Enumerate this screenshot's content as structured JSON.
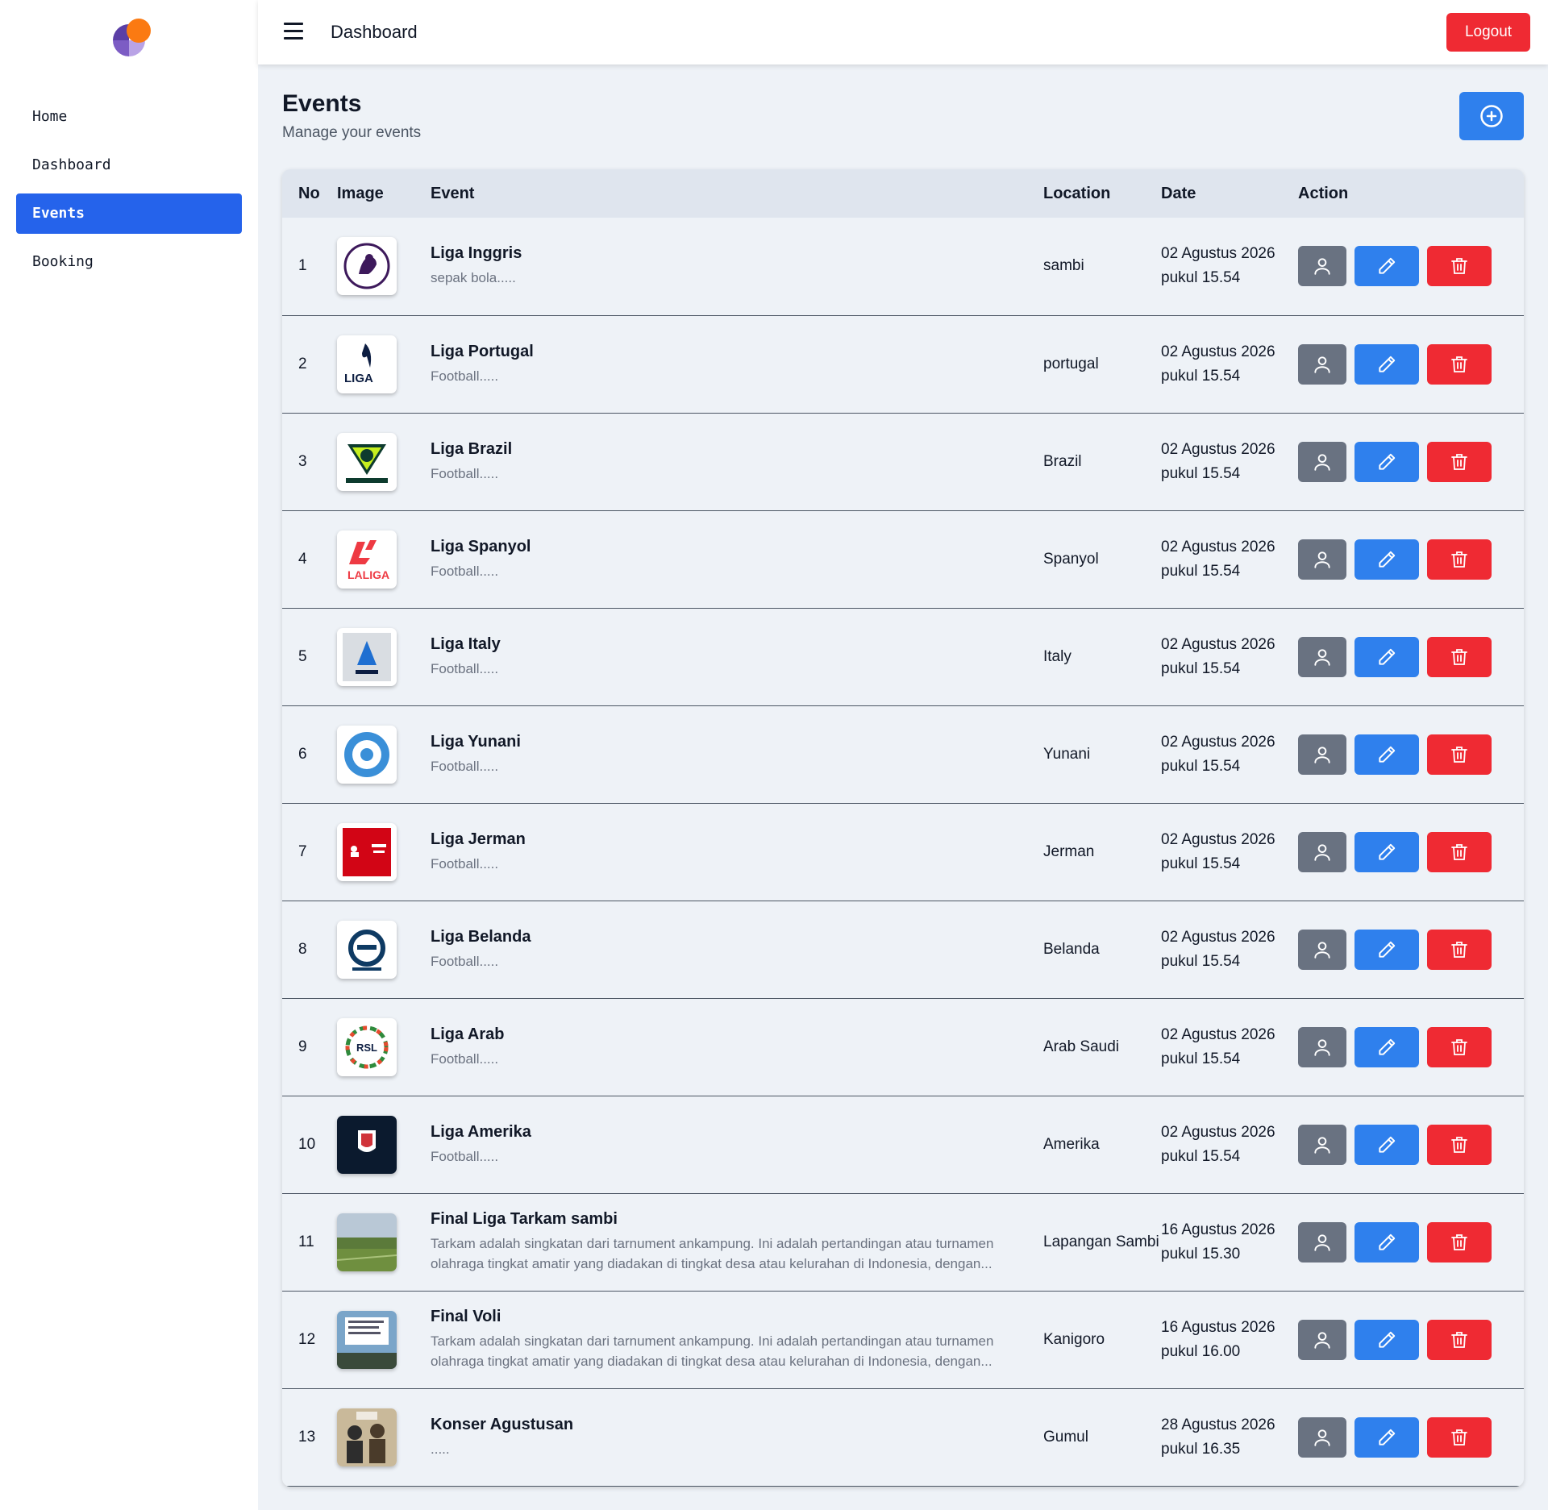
{
  "sidebar": {
    "logo": "app-logo",
    "items": [
      {
        "label": "Home",
        "active": false
      },
      {
        "label": "Dashboard",
        "active": false
      },
      {
        "label": "Events",
        "active": true
      },
      {
        "label": "Booking",
        "active": false
      }
    ]
  },
  "topbar": {
    "title": "Dashboard",
    "logout_label": "Logout"
  },
  "page": {
    "title": "Events",
    "subtitle": "Manage your events",
    "add_icon": "plus-circle-icon"
  },
  "table": {
    "headers": {
      "no": "No",
      "image": "Image",
      "event": "Event",
      "location": "Location",
      "date": "Date",
      "action": "Action"
    },
    "rows": [
      {
        "no": "1",
        "image": "Premier League logo",
        "name": "Liga Inggris",
        "desc": "sepak bola.....",
        "location": "sambi",
        "date": "02 Agustus 2026 pukul 15.54"
      },
      {
        "no": "2",
        "image": "Liga Portugal logo",
        "name": "Liga Portugal",
        "desc": "Football.....",
        "location": "portugal",
        "date": "02 Agustus 2026 pukul 15.54"
      },
      {
        "no": "3",
        "image": "Brasileirão logo",
        "name": "Liga Brazil",
        "desc": "Football.....",
        "location": "Brazil",
        "date": "02 Agustus 2026 pukul 15.54"
      },
      {
        "no": "4",
        "image": "LaLiga logo",
        "name": "Liga Spanyol",
        "desc": "Football.....",
        "location": "Spanyol",
        "date": "02 Agustus 2026 pukul 15.54"
      },
      {
        "no": "5",
        "image": "Serie A logo",
        "name": "Liga Italy",
        "desc": "Football.....",
        "location": "Italy",
        "date": "02 Agustus 2026 pukul 15.54"
      },
      {
        "no": "6",
        "image": "Hellenic Football Federation logo",
        "name": "Liga Yunani",
        "desc": "Football.....",
        "location": "Yunani",
        "date": "02 Agustus 2026 pukul 15.54"
      },
      {
        "no": "7",
        "image": "Bundesliga logo",
        "name": "Liga Jerman",
        "desc": "Football.....",
        "location": "Jerman",
        "date": "02 Agustus 2026 pukul 15.54"
      },
      {
        "no": "8",
        "image": "Eredivisie logo",
        "name": "Liga Belanda",
        "desc": "Football.....",
        "location": "Belanda",
        "date": "02 Agustus 2026 pukul 15.54"
      },
      {
        "no": "9",
        "image": "Saudi Pro League logo",
        "name": "Liga Arab",
        "desc": "Football.....",
        "location": "Arab Saudi",
        "date": "02 Agustus 2026 pukul 15.54"
      },
      {
        "no": "10",
        "image": "MLS logo",
        "name": "Liga Amerika",
        "desc": "Football.....",
        "location": "Amerika",
        "date": "02 Agustus 2026 pukul 15.54"
      },
      {
        "no": "11",
        "image": "football field photo",
        "name": "Final Liga Tarkam sambi",
        "desc": "Tarkam adalah singkatan dari tarnument ankampung. Ini adalah pertandingan atau turnamen olahraga tingkat amatir yang diadakan di tingkat desa atau kelurahan di Indonesia, dengan...",
        "location": "Lapangan Sambi",
        "date": "16 Agustus 2026 pukul 15.30"
      },
      {
        "no": "12",
        "image": "volleyball poster",
        "name": "Final Voli",
        "desc": "Tarkam adalah singkatan dari tarnument ankampung. Ini adalah pertandingan atau turnamen olahraga tingkat amatir yang diadakan di tingkat desa atau kelurahan di Indonesia, dengan...",
        "location": "Kanigoro",
        "date": "16 Agustus 2026 pukul 16.00"
      },
      {
        "no": "13",
        "image": "concert poster",
        "name": "Konser Agustusan",
        "desc": ".....",
        "location": "Gumul",
        "date": "28 Agustus 2026 pukul 16.35"
      }
    ],
    "action_icons": {
      "view": "user-icon",
      "edit": "pencil-icon",
      "delete": "trash-icon"
    }
  },
  "colors": {
    "primary": "#2563eb",
    "button_blue": "#2f80ed",
    "danger": "#ef2a33",
    "neutral": "#697281",
    "background": "#eef2f7"
  }
}
